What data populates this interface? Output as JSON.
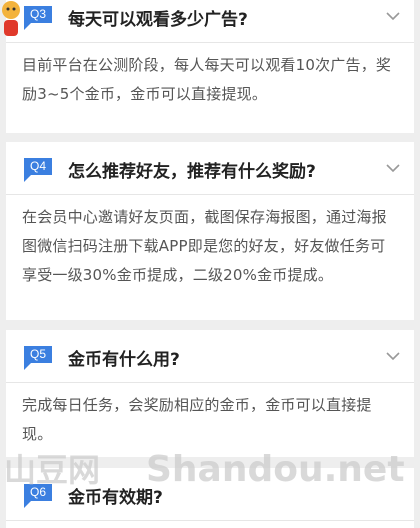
{
  "faq": [
    {
      "badge": "Q3",
      "question": "每天可以观看多少广告?",
      "answer": "目前平台在公测阶段，每人每天可以观看10次广告，奖励3~5个金币，金币可以直接提现。"
    },
    {
      "badge": "Q4",
      "question": "怎么推荐好友，推荐有什么奖励?",
      "answer": "在会员中心邀请好友页面，截图保存海报图，通过海报图微信扫码注册下载APP即是您的好友，好友做任务可享受一级30%金币提成，二级20%金币提成。"
    },
    {
      "badge": "Q5",
      "question": "金币有什么用?",
      "answer": "完成每日任务，会奖励相应的金币，金币可以直接提现。"
    },
    {
      "badge": "Q6",
      "question": "金币有效期?",
      "answer": ""
    }
  ],
  "watermark": {
    "cn": "山豆网",
    "en": "Shandou.net"
  },
  "colors": {
    "badge": "#3b7fe0",
    "background": "#eeeeee",
    "card": "#ffffff"
  }
}
